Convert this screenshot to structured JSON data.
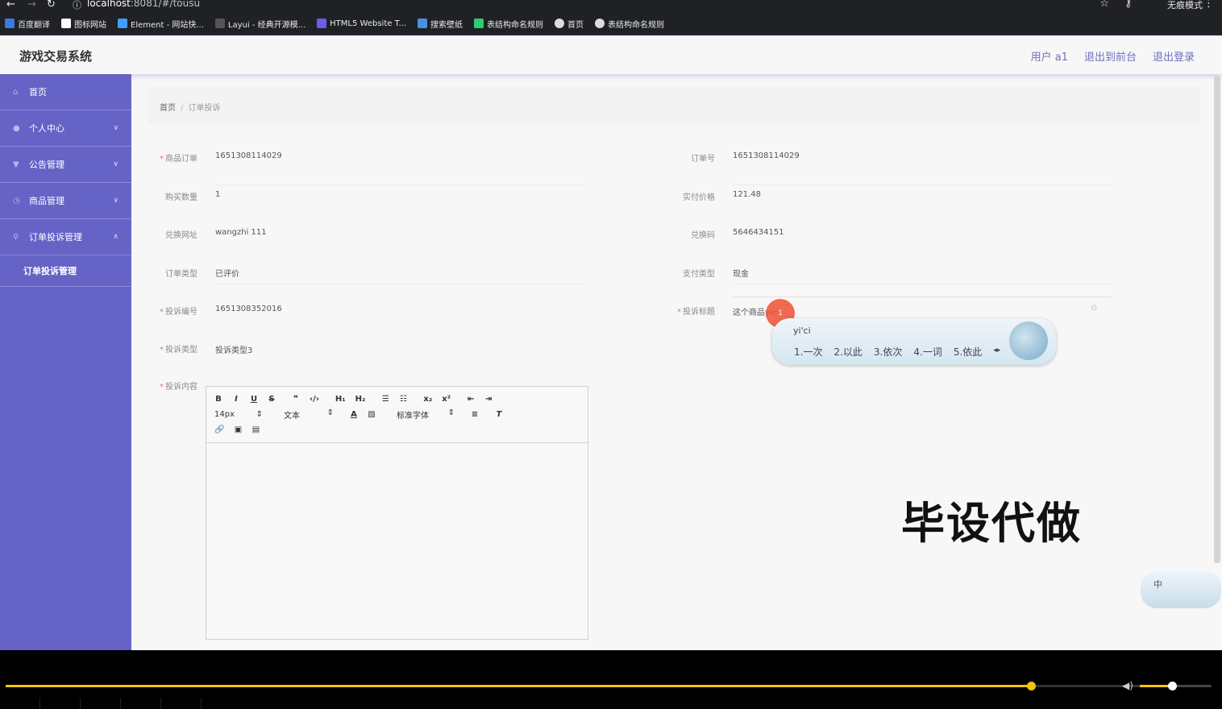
{
  "browser": {
    "url_host": "localhost",
    "url_rest": ":8081/#/tousu",
    "incognito": "无痕模式",
    "bookmarks": [
      "百度翻译",
      "图标网站",
      "Element - 网站快...",
      "Layui - 经典开源模...",
      "HTML5 Website T...",
      "搜索壁纸",
      "表结构命名规则",
      "首页",
      "表结构命名规则"
    ]
  },
  "header": {
    "brand": "游戏交易系统",
    "user": "用户 a1",
    "to_front": "退出到前台",
    "logout": "退出登录"
  },
  "sidebar": {
    "items": [
      {
        "label": "首页",
        "icon": "home-icon"
      },
      {
        "label": "个人中心",
        "icon": "user-icon"
      },
      {
        "label": "公告管理",
        "icon": "notice-icon"
      },
      {
        "label": "商品管理",
        "icon": "goods-icon"
      },
      {
        "label": "订单投诉管理",
        "icon": "complaint-icon"
      }
    ],
    "sub_item": "订单投诉管理"
  },
  "breadcrumb": {
    "home": "首页",
    "current": "订单投诉"
  },
  "form": {
    "order_label": "商品订单",
    "order_value": "1651308114029",
    "order_no_label": "订单号",
    "order_no_value": "1651308114029",
    "qty_label": "购买数量",
    "qty_value": "1",
    "price_label": "实付价格",
    "price_value": "121.48",
    "redeem_url_label": "兑换网址",
    "redeem_url_value": "wangzhi 111",
    "redeem_code_label": "兑换码",
    "redeem_code_value": "5646434151",
    "order_type_label": "订单类型",
    "order_type_value": "已评价",
    "pay_type_label": "支付类型",
    "pay_type_value": "现金",
    "complaint_no_label": "投诉编号",
    "complaint_no_value": "1651308352016",
    "complaint_title_label": "投诉标题",
    "complaint_title_value": "这个商品yic'i",
    "complaint_type_label": "投诉类型",
    "complaint_type_value": "投诉类型3",
    "content_label": "投诉内容"
  },
  "editor": {
    "toolbar_row1": [
      "B",
      "I",
      "U",
      "S",
      "❞",
      "‹/›",
      "H₁",
      "H₂",
      "☰",
      "☷",
      "x₂",
      "x²",
      "⇤",
      "⇥"
    ],
    "font_size": "14px",
    "block": "文本",
    "font_family": "标准字体",
    "toolbar_row3": [
      "🔗",
      "▣",
      "▤"
    ]
  },
  "ime": {
    "input": "yi'ci",
    "candidates": [
      "1.一次",
      "2.以此",
      "3.依次",
      "4.一词",
      "5.依此"
    ],
    "mini": "中"
  },
  "cursor": "1",
  "watermark": "毕设代做",
  "video": {
    "progress": 0.85,
    "volume": 0.45
  }
}
